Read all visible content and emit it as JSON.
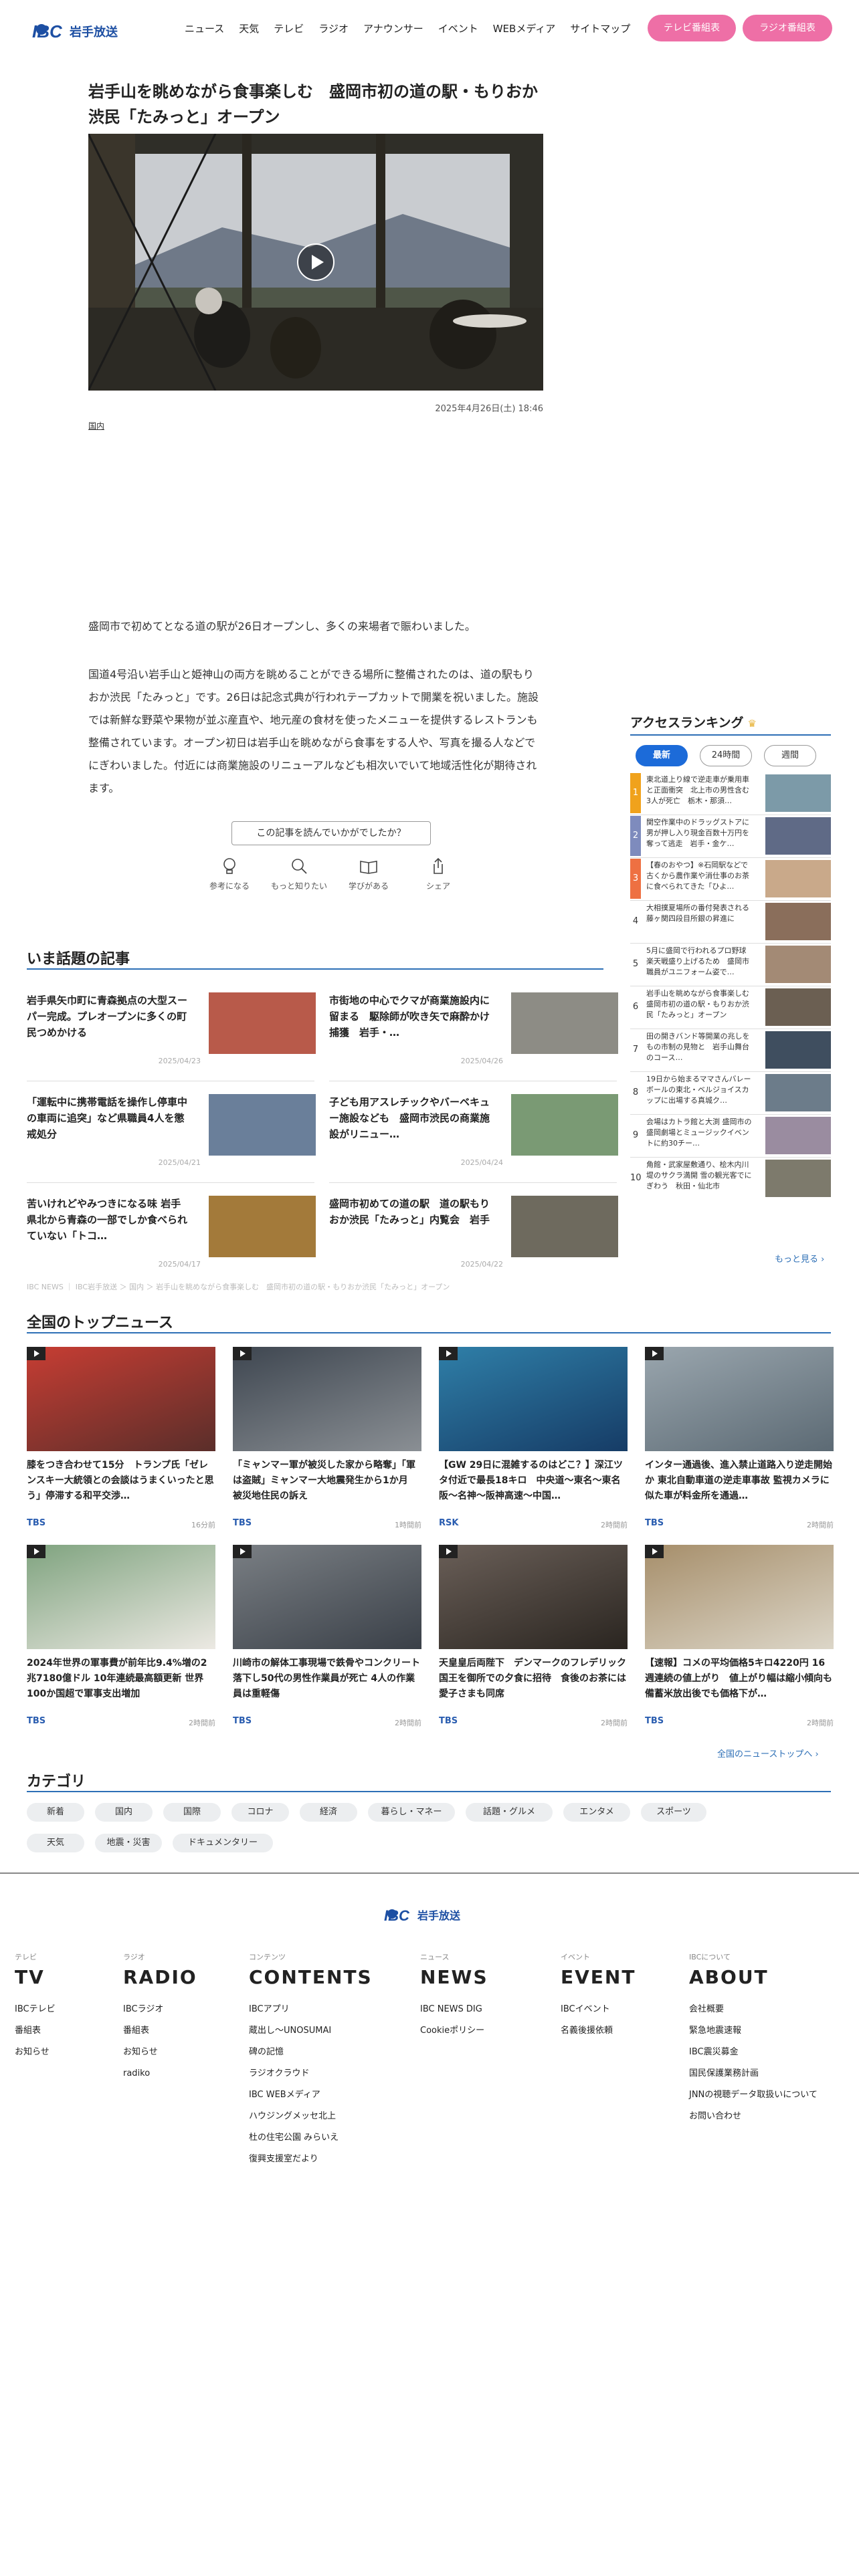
{
  "header": {
    "nav": [
      "ニュース",
      "天気",
      "テレビ",
      "ラジオ",
      "アナウンサー",
      "イベント",
      "WEBメディア",
      "サイトマップ"
    ],
    "tv_program": "テレビ番組表",
    "radio_program": "ラジオ番組表",
    "logo": "IBC 岩手放送"
  },
  "article": {
    "title": "岩手山を眺めながら食事楽しむ　盛岡市初の道の駅・もりおか渋民「たみっと」オープン",
    "date": "2025年4月26日(土) 18:46",
    "tag": "国内",
    "lead": "盛岡市で初めてとなる道の駅が26日オープンし、多くの来場者で賑わいました。",
    "body": "国道4号沿い岩手山と姫神山の両方を眺めることができる場所に整備されたのは、道の駅もりおか渋民「たみっと」です。26日は記念式典が行われテープカットで開業を祝いました。施設では新鮮な野菜や果物が並ぶ産直や、地元産の食材を使ったメニューを提供するレストランも整備されています。オープン初日は岩手山を眺めながら食事をする人や、写真を撮る人などでにぎわいました。付近には商業施設のリニューアルなども相次いでいて地域活性化が期待されます。",
    "feedback": "この記事を読んでいかがでしたか？",
    "reactions": [
      "参考になる",
      "もっと知りたい",
      "学びがある",
      "シェア"
    ]
  },
  "hot": {
    "heading": "いま話題の記事",
    "items": [
      {
        "title": "岩手県矢巾町に青森拠点の大型スーパー完成。プレオープンに多くの町民つめかける",
        "date": "2025/04/23"
      },
      {
        "title": "市街地の中心でクマが商業施設内に留まる　駆除師が吹き矢で麻酔かけ捕獲　岩手・…",
        "date": "2025/04/26"
      },
      {
        "title": "「運転中に携帯電話を操作し停車中の車両に追突」など県職員4人を懲戒処分",
        "date": "2025/04/21"
      },
      {
        "title": "子ども用アスレチックやバーベキュー施設なども　盛岡市渋民の商業施設がリニュー…",
        "date": "2025/04/24"
      },
      {
        "title": "苦いけれどやみつきになる味 岩手県北から青森の一部でしか食べられていない「トコ…",
        "date": "2025/04/17"
      },
      {
        "title": "盛岡市初めての道の駅　道の駅もりおか渋民「たみっと」内覧会　岩手",
        "date": "2025/04/22"
      }
    ]
  },
  "ranking": {
    "heading": "アクセスランキング",
    "tabs": [
      "最新",
      "24時間",
      "週間"
    ],
    "items": [
      {
        "n": "1",
        "t": "東北道上り線で逆走車が乗用車と正面衝突　北上市の男性含む3人が死亡　栃木・那須…"
      },
      {
        "n": "2",
        "t": "関空作業中のドラッグストアに男が押し入り現金百数十万円を奪って逃走　岩手・金ケ…"
      },
      {
        "n": "3",
        "t": "【春のおやつ】※石岡駅などで古くから農作業や消仕事のお茶に食べられてきた「ひよ…"
      },
      {
        "n": "4",
        "t": "大相撲夏場所の番付発表される 藤ヶ関四段目所銀の昇進に"
      },
      {
        "n": "5",
        "t": "5月に盛岡で行われるプロ野球楽天戦盛り上げるため　盛岡市職員がユニフォーム姿で…"
      },
      {
        "n": "6",
        "t": "岩手山を眺めながら食事楽しむ　盛岡市初の道の駅・もりおか渋民「たみっと」オープン"
      },
      {
        "n": "7",
        "t": "田の開きバンド等開業の兆しをもの市制の見物と　岩手山舞台のコース…"
      },
      {
        "n": "8",
        "t": "19日から始まるママさんバレーボールの東北・ベルジョイスカップに出場する真城ク…"
      },
      {
        "n": "9",
        "t": "会場はカトラ館と大渕 盛岡市の盛岡劇場とミュージックイベントに約30チー…"
      },
      {
        "n": "10",
        "t": "角館・武家屋敷通り、桧木内川堤のサクラ満開 雪の観光客でにぎわう　秋田・仙北市"
      }
    ],
    "more": "もっと見る"
  },
  "breadcrumb": "IBC NEWS ｜ IBC岩手放送 ＞ 国内 ＞ 岩手山を眺めながら食事楽しむ　盛岡市初の道の駅・もりおか渋民「たみっと」オープン",
  "national": {
    "heading": "全国のトップニュース",
    "more": "全国のニューストップへ",
    "items": [
      {
        "title": "膝をつき合わせて15分　トランプ氏「ゼレンスキー大統領との会談はうまくいったと思う」停滞する和平交渉…",
        "src": "TBS",
        "time": "16分前"
      },
      {
        "title": "「ミャンマー軍が被災した家から略奪」「軍は盗賊」ミャンマー大地震発生から1か月　被災地住民の訴え",
        "src": "TBS",
        "time": "1時間前"
      },
      {
        "title": "【GW 29日に混雑するのはどこ？】深江ツタ付近で最長18キロ　中央道〜東名〜東名阪〜名神〜阪神高速〜中国…",
        "src": "RSK",
        "time": "2時間前"
      },
      {
        "title": "インター通過後、進入禁止道路入り逆走開始か 東北自動車道の逆走車事故 監視カメラに似た車が料金所を通過…",
        "src": "TBS",
        "time": "2時間前"
      },
      {
        "title": "2024年世界の軍事費が前年比9.4%増の2兆7180億ドル 10年連続最高額更新 世界100か国超で軍事支出増加",
        "src": "TBS",
        "time": "2時間前"
      },
      {
        "title": "川崎市の解体工事現場で鉄骨やコンクリート落下し50代の男性作業員が死亡 4人の作業員は重軽傷",
        "src": "TBS",
        "time": "2時間前"
      },
      {
        "title": "天皇皇后両陛下　デンマークのフレデリック国王を御所での夕食に招待　食後のお茶には愛子さまも同席",
        "src": "TBS",
        "time": "2時間前"
      },
      {
        "title": "【速報】コメの平均価格5キロ4220円 16週連続の値上がり　値上がり幅は縮小傾向も備蓄米放出後でも価格下が…",
        "src": "TBS",
        "time": "2時間前"
      }
    ]
  },
  "category": {
    "heading": "カテゴリ",
    "items": [
      "新着",
      "国内",
      "国際",
      "コロナ",
      "経済",
      "暮らし・マネー",
      "話題・グルメ",
      "エンタメ",
      "スポーツ",
      "天気",
      "地震・災害",
      "ドキュメンタリー"
    ]
  },
  "footer": {
    "logo": "IBC 岩手放送",
    "cols": [
      {
        "small": "テレビ",
        "big": "TV",
        "links": [
          "IBCテレビ",
          "番組表",
          "お知らせ"
        ]
      },
      {
        "small": "ラジオ",
        "big": "RADIO",
        "links": [
          "IBCラジオ",
          "番組表",
          "お知らせ",
          "radiko"
        ]
      },
      {
        "small": "コンテンツ",
        "big": "CONTENTS",
        "links": [
          "IBCアプリ",
          "蔵出し〜UNOSUMAI",
          "碑の記憶",
          "ラジオクラウド",
          "IBC WEBメディア",
          "ハウジングメッセ北上",
          "杜の住宅公園 みらいえ",
          "復興支援室だより"
        ]
      },
      {
        "small": "ニュース",
        "big": "NEWS",
        "links": [
          "IBC NEWS DIG",
          "Cookieポリシー"
        ]
      },
      {
        "small": "イベント",
        "big": "EVENT",
        "links": [
          "IBCイベント",
          "名義後援依頼"
        ]
      },
      {
        "small": "IBCについて",
        "big": "ABOUT",
        "links": [
          "会社概要",
          "緊急地震速報",
          "IBC震災募金",
          "国民保護業務計画",
          "JNNの視聴データ取扱いについて",
          "お問い合わせ"
        ]
      }
    ]
  },
  "colors": {
    "accent": "#2d6fb6",
    "pink": "#ee6fa6"
  }
}
